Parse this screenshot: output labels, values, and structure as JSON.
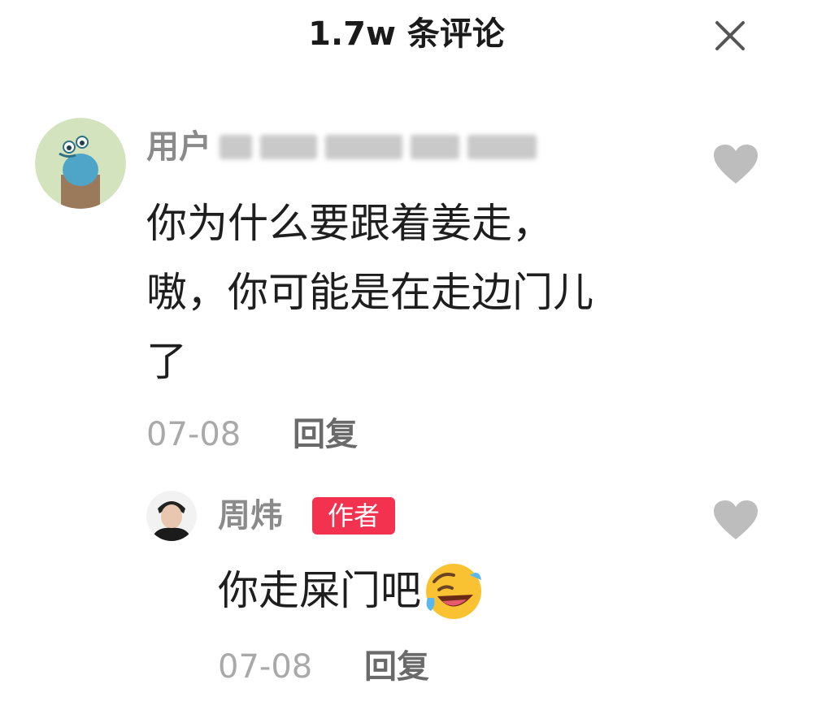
{
  "header": {
    "title": "1.7w 条评论",
    "close_icon": "close-icon"
  },
  "comments": [
    {
      "username_visible": "用户",
      "username_obscured": true,
      "text_lines": [
        "你为什么要跟着姜走，",
        "嗷，你可能是在走边门儿",
        "了"
      ],
      "date": "07-08",
      "reply_label": "回复",
      "like_icon": "heart-icon"
    },
    {
      "username": "周炜",
      "badge": "作者",
      "text": "你走屎门吧",
      "emoji": "rolling-on-floor-laughing-emoji",
      "date": "07-08",
      "reply_label": "回复",
      "like_icon": "heart-icon"
    }
  ],
  "colors": {
    "badge_background": "#f2324f",
    "meta_text": "#a9a9a9",
    "username_text": "#8a8a8a",
    "heart_gray": "#bdbdbd"
  }
}
